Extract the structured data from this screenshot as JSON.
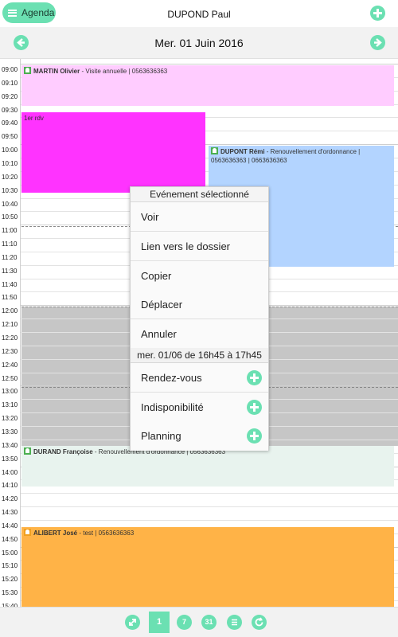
{
  "header": {
    "menu_label": "Agenda",
    "user_name": "DUPOND Paul"
  },
  "datebar": {
    "date_title": "Mer. 01 Juin 2016"
  },
  "times": [
    "09:00",
    "09:10",
    "09:20",
    "09:30",
    "09:40",
    "09:50",
    "10:00",
    "10:10",
    "10:20",
    "10:30",
    "10:40",
    "10:50",
    "11:00",
    "11:10",
    "11:20",
    "11:30",
    "11:40",
    "11:50",
    "12:00",
    "12:10",
    "12:20",
    "12:30",
    "12:40",
    "12:50",
    "13:00",
    "13:10",
    "13:20",
    "13:30",
    "13:40",
    "13:50",
    "14:00",
    "14:10",
    "14:20",
    "14:30",
    "14:40",
    "14:50",
    "15:00",
    "15:10",
    "15:20",
    "15:30",
    "15:40"
  ],
  "events": {
    "martin": {
      "name": "MARTIN Olivier",
      "detail": " - Visite annuelle | 0563636363",
      "color": "#ffccff"
    },
    "rdv": {
      "label": "1er rdv",
      "color": "#ff33ff"
    },
    "dupont": {
      "name": "DUPONT Rémi",
      "detail": " - Renouvellement d'ordonnance | 0563636363 | 0663636363",
      "color": "#b3d4ff"
    },
    "durand": {
      "name": "DURAND Françoise",
      "detail": " - Renouvellement d'ordonnance | 0563636363",
      "color": "#e8f3ee"
    },
    "alibert": {
      "name": "ALIBERT José",
      "detail": " - test | 0563636363",
      "color": "#ffb347"
    }
  },
  "context_menu": {
    "title": "Evénement sélectionné",
    "items": [
      "Voir",
      "Lien vers le dossier",
      "Copier",
      "Déplacer",
      "Annuler"
    ],
    "range": "mer. 01/06 de 16h45 à 17h45",
    "add_items": [
      "Rendez-vous",
      "Indisponibilité",
      "Planning"
    ]
  },
  "footer": {
    "day_view_label": "1",
    "week_view_label": "7",
    "month_view_label": "31"
  },
  "colors": {
    "accent": "#6be0b2",
    "unavailable": "#c6c6c6"
  },
  "icons": [
    "menu-icon",
    "add-icon",
    "prev-arrow-icon",
    "next-arrow-icon",
    "expand-icon",
    "list-icon",
    "refresh-icon"
  ]
}
